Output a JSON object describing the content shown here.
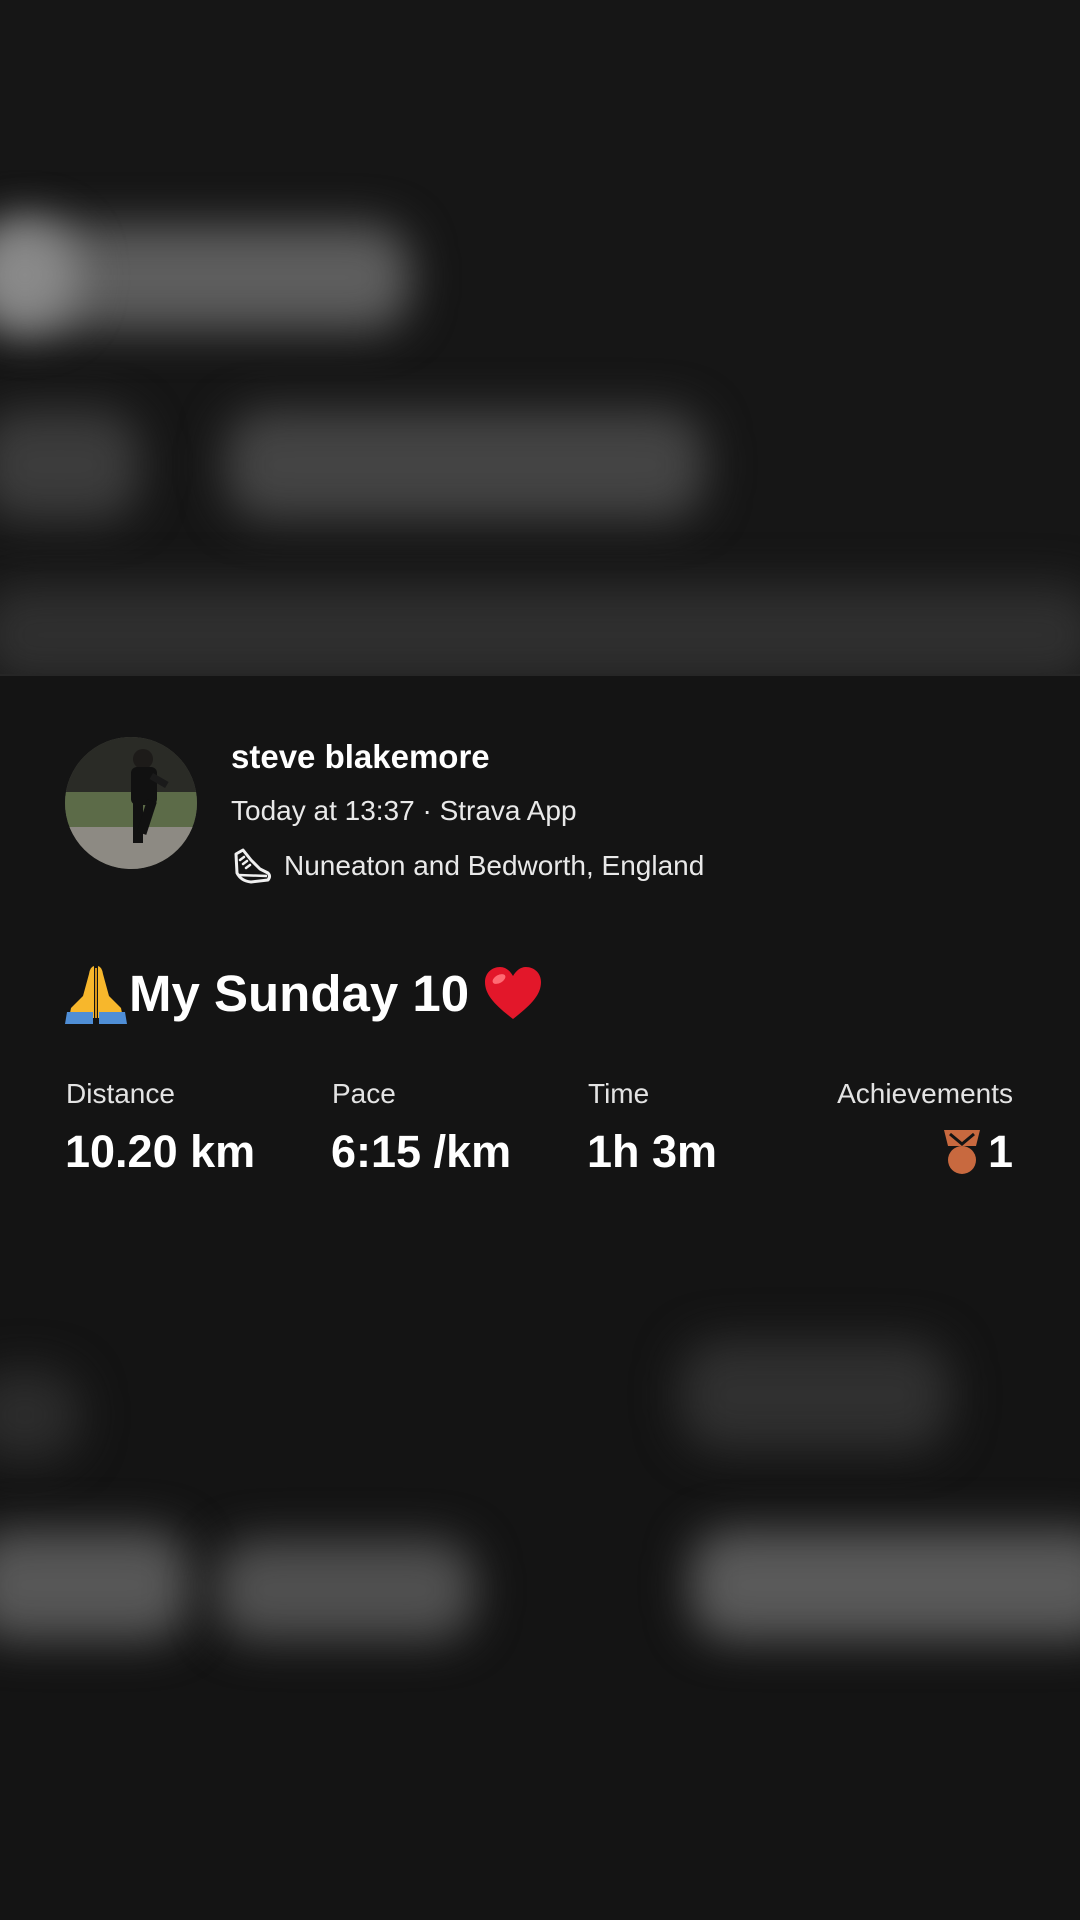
{
  "activity": {
    "athlete_name": "steve blakemore",
    "meta": "Today at 13:37 · Strava App",
    "location": "Nuneaton and Bedworth, England",
    "title": "My Sunday 10"
  },
  "stats": {
    "distance_label": "Distance",
    "distance_value": "10.20 km",
    "pace_label": "Pace",
    "pace_value": "6:15 /km",
    "time_label": "Time",
    "time_value": "1h 3m",
    "achievements_label": "Achievements",
    "achievements_value": "1"
  },
  "icons": {
    "activity_type": "running-shoe-icon",
    "title_leading": "praying-hands-emoji",
    "title_trailing": "red-heart-emoji",
    "achievement": "bronze-medal-icon"
  },
  "colors": {
    "background": "#141414",
    "medal": "#c8693f",
    "heart": "#e3172a"
  }
}
